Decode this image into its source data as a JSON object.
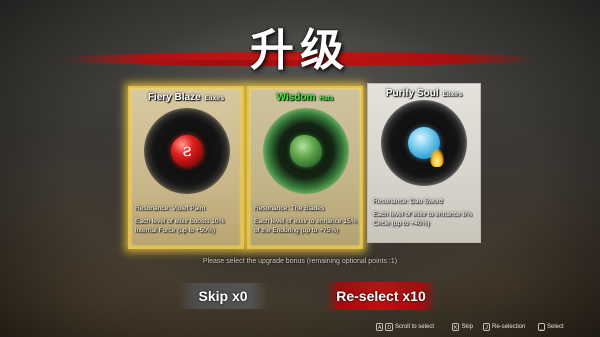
{
  "title": "升级",
  "cards": [
    {
      "name": "Fiery Blaze",
      "tag": "Elixirs",
      "resonance": "Resonance: Violet Palm",
      "effect": "Each level of elixir boosts 10% internal Force (up to +50%)",
      "orb_glyph": "ƨ",
      "color": "#e02020"
    },
    {
      "name": "Wisdom",
      "tag": "Hats",
      "resonance": "Resonance: The Blades",
      "effect": "Each level of elixir to enhance 15% of the Enduring (up to +75%)",
      "color": "#3cf03c"
    },
    {
      "name": "Purify Soul",
      "tag": "Elixirs",
      "resonance": "Resonance: Dao Sword",
      "effect": "Each level of elixir to enhance 8% Circle (up to +40%)",
      "color": "#7fd0f0"
    }
  ],
  "prompt": "Please select the upgrade bonus (remaining optional points :1)",
  "buttons": {
    "skip": "Skip x0",
    "reselect": "Re-select x10"
  },
  "hints": [
    {
      "keys": [
        "A",
        "D"
      ],
      "label": "Scroll to select",
      "icon": "key-a-d"
    },
    {
      "keys": [
        "K"
      ],
      "label": "Skip",
      "icon": "key-k"
    },
    {
      "keys": [
        "J"
      ],
      "label": "Re-selection",
      "icon": "key-j"
    },
    {
      "keys": [
        "⎵"
      ],
      "label": "Select",
      "icon": "spacebar-icon"
    }
  ],
  "colors": {
    "accent_red": "#b81313",
    "card_glow": "#f4d35e",
    "selected_name": "#3cf03c"
  }
}
